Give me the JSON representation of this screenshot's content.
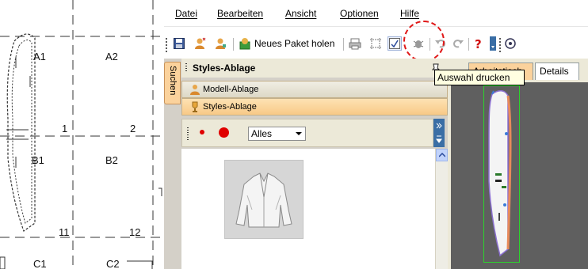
{
  "pattern": {
    "labels": [
      "A1",
      "A2",
      "1",
      "2",
      "B1",
      "B2",
      "11",
      "12",
      "C1",
      "C2"
    ]
  },
  "menu": {
    "items": [
      "Datei",
      "Bearbeiten",
      "Ansicht",
      "Optionen",
      "Hilfe"
    ]
  },
  "toolbar": {
    "buttons": [
      {
        "icon": "save-icon"
      },
      {
        "icon": "user-add-icon"
      },
      {
        "icon": "user-icon"
      },
      {
        "icon": "package-icon",
        "label": "Neues Paket holen"
      },
      {
        "icon": "print-icon"
      },
      {
        "icon": "page-select-icon"
      },
      {
        "icon": "print-selection-icon"
      },
      {
        "icon": "bug-icon"
      },
      {
        "icon": "undo-icon"
      },
      {
        "icon": "redo-icon"
      },
      {
        "icon": "help-icon"
      }
    ],
    "tooltip": "Auswahl drucken"
  },
  "side_tab": {
    "label": "Suchen"
  },
  "styles_pane": {
    "title": "Styles-Ablage",
    "nav": [
      {
        "label": "Modell-Ablage",
        "icon": "user-icon"
      },
      {
        "label": "Styles-Ablage",
        "icon": "trophy-icon"
      }
    ],
    "filter": {
      "selected": "Alles"
    }
  },
  "preview_pane": {
    "tabs": [
      "Arbeitstisch",
      "Details"
    ]
  },
  "colors": {
    "accent_orange": "#fbd29c",
    "highlight_ring": "#e01818",
    "tooltip_bg": "#ffffe1",
    "preview_bg": "#5f5f5f",
    "selection_box": "#2cd42c"
  }
}
